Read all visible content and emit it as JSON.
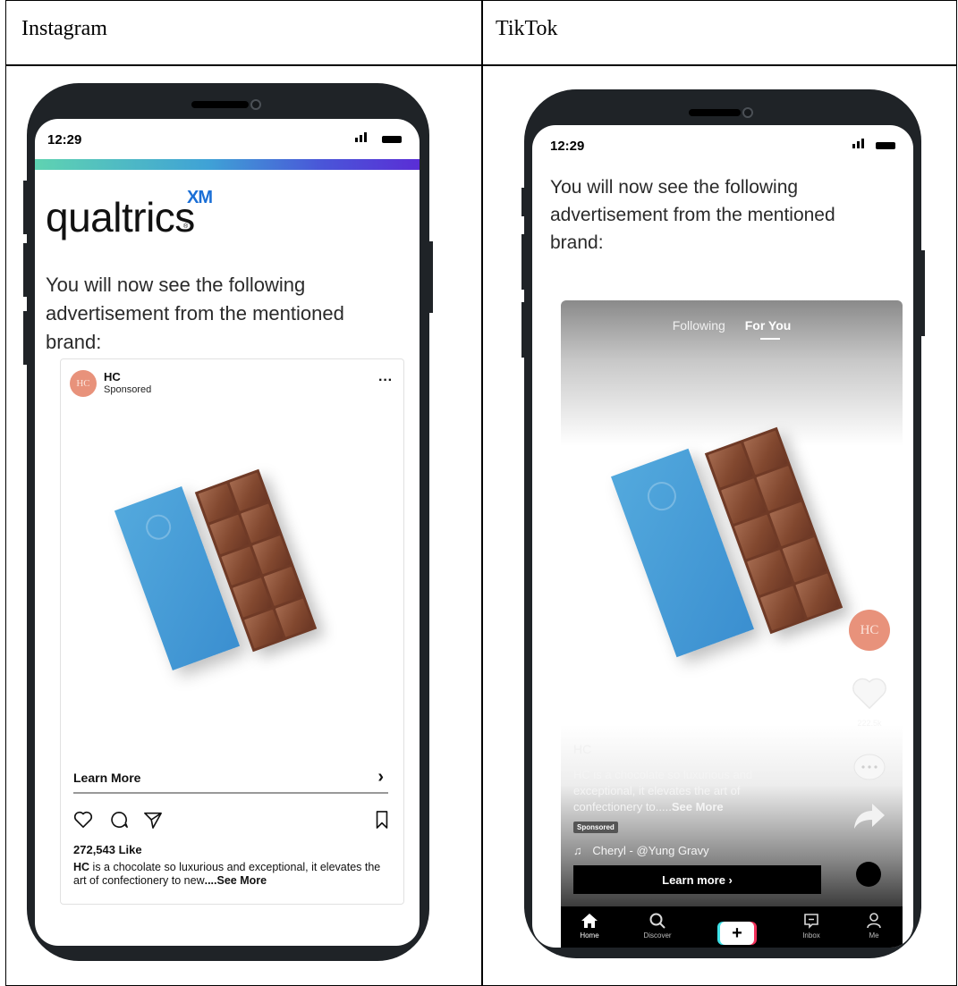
{
  "table": {
    "left_header": "Instagram",
    "right_header": "TikTok"
  },
  "status": {
    "time": "12:29"
  },
  "instagram": {
    "logo_text": "qualtrics",
    "logo_xm": "XM",
    "logo_reg": "®",
    "intro": "You will now see the following advertisement from the mentioned brand:",
    "post": {
      "avatar_text": "HC",
      "brand": "HC",
      "sponsored": "Sponsored",
      "more": "···",
      "learn_more": "Learn More",
      "chevron": "›",
      "likes": "272,543 Like",
      "caption_brand": "HC",
      "caption_text": " is a chocolate so luxurious and exceptional, it elevates the art of confectionery to new",
      "caption_more": "....See More"
    }
  },
  "tiktok": {
    "intro": "You will now see the following advertisement from the mentioned brand:",
    "tabs": {
      "following": "Following",
      "for_you": "For You"
    },
    "brand": "HC",
    "caption": "HC is a chocolate so luxurious and exceptional, it elevates the art of confectionery to.....",
    "caption_more": "See More",
    "sponsored": "Sponsored",
    "music": "Cheryl - @Yung Gravy",
    "learn_more": "Learn more ›",
    "avatar_text": "HC",
    "like_count": "222.5k",
    "nav": {
      "home": "Home",
      "discover": "Discover",
      "inbox": "Inbox",
      "me": "Me",
      "plus": "+"
    }
  },
  "colors": {
    "avatar": "#e8927b",
    "product_box": "#4a9fda",
    "chocolate": "#7a4430",
    "qualtrics_xm": "#1b6fd6"
  }
}
